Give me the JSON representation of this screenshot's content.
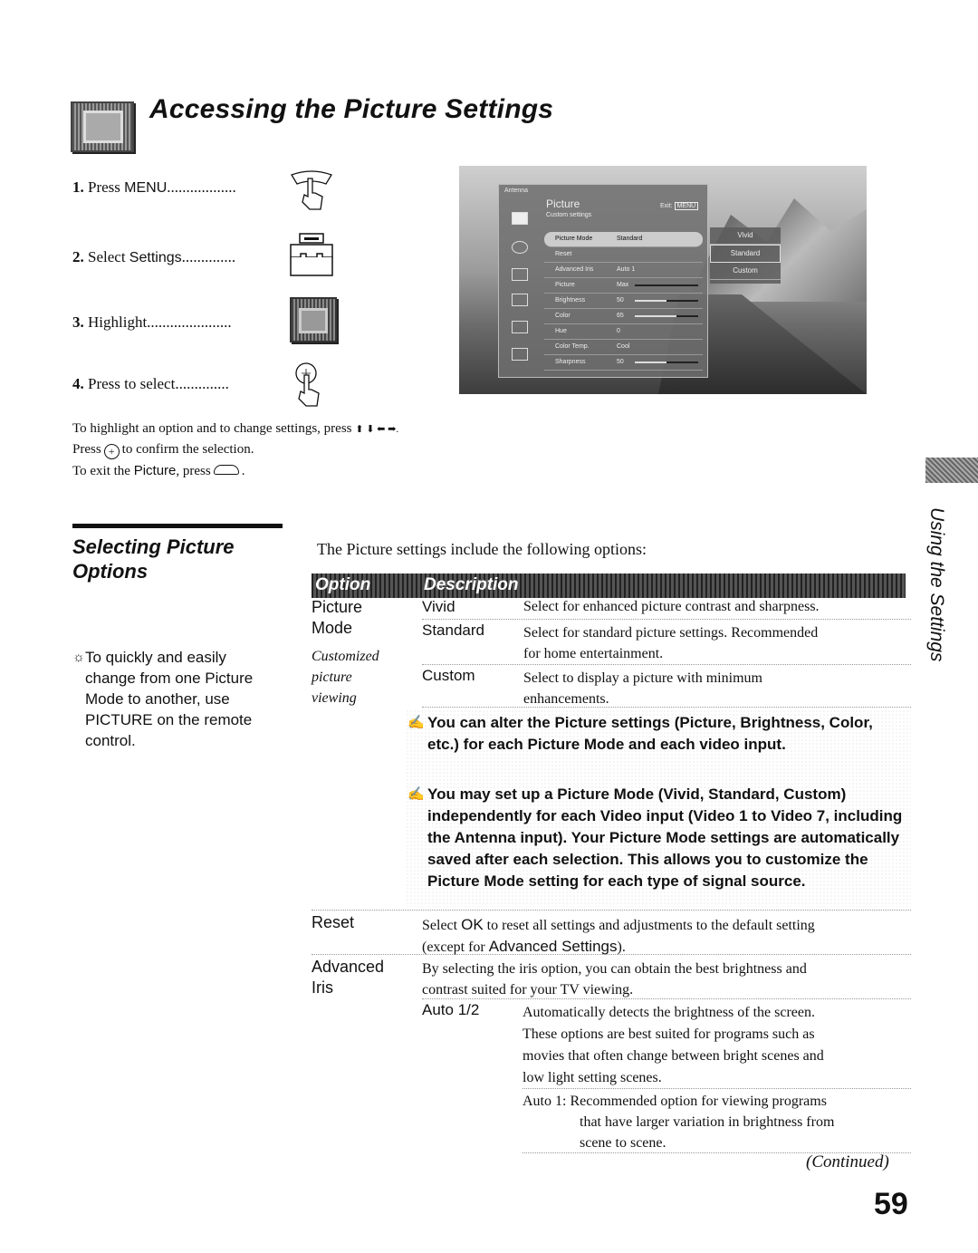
{
  "header": {
    "title": "Accessing the Picture Settings",
    "icon": "picture-settings-icon"
  },
  "steps": [
    {
      "num": "1.",
      "pre": "Press ",
      "kw": "MENU",
      "dots": "..................",
      "icon": "menu-button-hand-icon"
    },
    {
      "num": "2.",
      "pre": "Select ",
      "kw": "Settings",
      "dots": "..............",
      "icon": "settings-toolbox-icon"
    },
    {
      "num": "3.",
      "pre": "Highlight",
      "kw": "",
      "dots": "......................",
      "icon": "picture-settings-icon"
    },
    {
      "num": "4.",
      "pre": "Press to select",
      "kw": "",
      "dots": "..............",
      "icon": "enter-button-hand-icon"
    }
  ],
  "tv_menu": {
    "source": "Antenna",
    "title": "Picture",
    "subtitle": "Custom settings",
    "exit_label": "Exit:",
    "exit_key": "MENU",
    "rows": [
      {
        "label": "Picture Mode",
        "value": "Standard",
        "selected": true
      },
      {
        "label": "Reset",
        "value": ""
      },
      {
        "label": "Advanced Iris",
        "value": "Auto 1"
      },
      {
        "label": "Picture",
        "value": "Max",
        "level": 1.0
      },
      {
        "label": "Brightness",
        "value": "50",
        "level": 0.5
      },
      {
        "label": "Color",
        "value": "65",
        "level": 0.35
      },
      {
        "label": "Hue",
        "value": "0"
      },
      {
        "label": "Color Temp.",
        "value": "Cool"
      },
      {
        "label": "Sharpness",
        "value": "50",
        "level": 0.5
      }
    ],
    "popup_options": [
      "Vivid",
      "Standard",
      "Custom"
    ],
    "popup_selected": "Standard"
  },
  "nav": {
    "line1": "To highlight an option and to change settings, press",
    "arrows": "⬆ ⬇ ⬅ ➡.",
    "line2_pre": "Press",
    "line2_post": "to confirm the selection.",
    "line3_pre": "To exit the",
    "line3_kw": "Picture",
    "line3_post": ", press",
    "line3_end": "."
  },
  "section": {
    "title": "Selecting Picture Options",
    "tip": "To quickly and easily change from one Picture Mode to another, use PICTURE on the remote control.",
    "intro": "The Picture settings include the following options:"
  },
  "side_tab": "Using the Settings",
  "table": {
    "headers": [
      "Option",
      "Description"
    ],
    "picture_mode": {
      "option": [
        "Picture",
        "Mode"
      ],
      "note": [
        "Customized",
        "picture",
        "viewing"
      ],
      "rows": [
        {
          "name": "Vivid",
          "desc": [
            "Select for enhanced picture contrast and sharpness."
          ]
        },
        {
          "name": "Standard",
          "desc": [
            "Select for standard picture settings. Recommended",
            "for home entertainment."
          ]
        },
        {
          "name": "Custom",
          "desc": [
            "Select to display a picture with minimum",
            "enhancements."
          ]
        }
      ],
      "notes": [
        "You can alter the Picture settings (Picture, Brightness, Color, etc.) for each Picture Mode and each video input.",
        "You may set up a Picture Mode (Vivid, Standard, Custom) independently for each Video input (Video 1 to Video 7, including the Antenna input). Your Picture Mode settings are automatically saved after each selection. This allows you to customize the Picture Mode setting for each type of signal source."
      ]
    },
    "reset": {
      "option": "Reset",
      "desc_pre": "Select ",
      "desc_kw": "OK",
      "desc_post": " to reset all settings and adjustments to the default setting",
      "desc2_pre": "(except for ",
      "desc2_kw": "Advanced Settings",
      "desc2_post": ")."
    },
    "advanced_iris": {
      "option": [
        "Advanced",
        "Iris"
      ],
      "desc": [
        "By selecting the iris option, you can obtain the best brightness and",
        "contrast suited for your TV viewing."
      ],
      "sub_name": "Auto 1/2",
      "sub_desc": [
        "Automatically detects the brightness of the screen.",
        "These options are best suited for programs such as",
        "movies that often change between bright scenes and",
        "low light setting scenes."
      ],
      "auto1": [
        "Auto 1: Recommended option for viewing programs",
        "that have larger variation in brightness from",
        "scene to scene."
      ]
    }
  },
  "footer": {
    "continued": "(Continued)",
    "page_number": "59"
  }
}
